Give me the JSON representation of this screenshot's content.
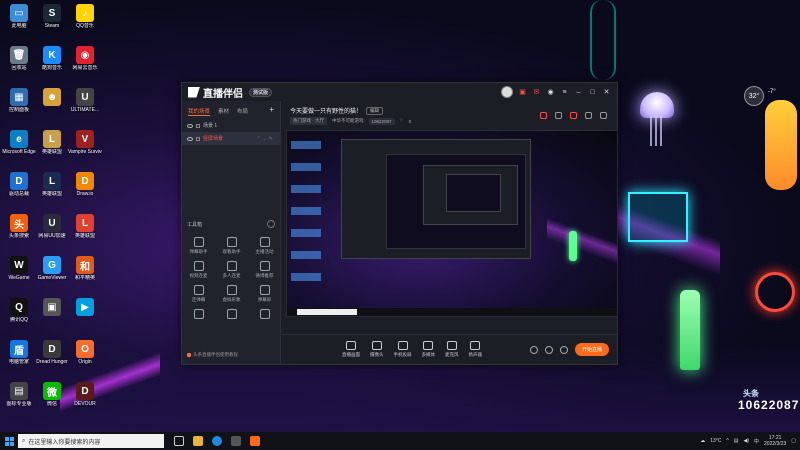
{
  "desktop": {
    "icons": [
      {
        "label": "此电脑",
        "color": "#3c8dd8",
        "glyph": "▭"
      },
      {
        "label": "Steam",
        "color": "#1b2838",
        "glyph": "S"
      },
      {
        "label": "QQ音乐",
        "color": "#ffd400",
        "glyph": "♪"
      },
      {
        "label": "回收站",
        "color": "#6a7a8a",
        "glyph": "🗑"
      },
      {
        "label": "酷狗音乐",
        "color": "#1a8cff",
        "glyph": "K"
      },
      {
        "label": "网易云音乐",
        "color": "#e0232f",
        "glyph": "◉"
      },
      {
        "label": "控制面板",
        "color": "#2f6bb0",
        "glyph": "▦"
      },
      {
        "label": "",
        "color": "#d7a23a",
        "glyph": "☻"
      },
      {
        "label": "ULTIMATE...",
        "color": "#444",
        "glyph": "U"
      },
      {
        "label": "Microsoft Edge",
        "color": "#0c7fc5",
        "glyph": "e"
      },
      {
        "label": "英雄联盟",
        "color": "#c9a04a",
        "glyph": "L"
      },
      {
        "label": "Vampire Survivors",
        "color": "#a02020",
        "glyph": "V"
      },
      {
        "label": "驱动总裁",
        "color": "#2070d0",
        "glyph": "D"
      },
      {
        "label": "英雄联盟",
        "color": "#1a2a50",
        "glyph": "L"
      },
      {
        "label": "Draw.io",
        "color": "#f08705",
        "glyph": "D"
      },
      {
        "label": "头条搜索",
        "color": "#f06010",
        "glyph": "头"
      },
      {
        "label": "网易UU加速",
        "color": "#2a2a3a",
        "glyph": "U"
      },
      {
        "label": "英雄联盟",
        "color": "#e04030",
        "glyph": "L"
      },
      {
        "label": "WeGame",
        "color": "#111",
        "glyph": "W"
      },
      {
        "label": "GameViewer",
        "color": "#2a9df4",
        "glyph": "G"
      },
      {
        "label": "和平精英",
        "color": "#e05a1a",
        "glyph": "和"
      },
      {
        "label": "腾讯QQ",
        "color": "#111",
        "glyph": "Q"
      },
      {
        "label": "",
        "color": "#555",
        "glyph": "▣"
      },
      {
        "label": "",
        "color": "#00a0e0",
        "glyph": "▶"
      },
      {
        "label": "电脑管家",
        "color": "#1676e0",
        "glyph": "盾"
      },
      {
        "label": "Dread Hunger",
        "color": "#3a3a3a",
        "glyph": "D"
      },
      {
        "label": "Origin",
        "color": "#f56c2d",
        "glyph": "O"
      },
      {
        "label": "图标专业版",
        "color": "#444",
        "glyph": "▤"
      },
      {
        "label": "微信",
        "color": "#09bb07",
        "glyph": "微"
      },
      {
        "label": "DEVOUR",
        "color": "#5a1a1a",
        "glyph": "D"
      }
    ]
  },
  "app": {
    "title": "直播伴侣",
    "version_tag": "测试版",
    "tabs": [
      "我的场景",
      "素材",
      "布局"
    ],
    "add_label": "+",
    "scenes": [
      {
        "name": "场景 1",
        "selected": false
      },
      {
        "name": "竖屏场景",
        "selected": true
      }
    ],
    "toolbox_title": "工具箱",
    "tools": [
      "弹幕助手",
      "观看助手",
      "主播活动",
      "视频连麦",
      "多人连麦",
      "微博推荐",
      "连弹幕",
      "虚拟形象",
      "弹幕屏",
      "",
      "",
      ""
    ],
    "notice": "头条直播伴侣使用教程",
    "stream_title": "今天要做一只有野性的猫！",
    "edit_label": "编辑",
    "meta": {
      "category": "热门游戏 · 大厅",
      "room_label": "中华不可能游戏",
      "room_id": "10622087",
      "likes": "0"
    },
    "controls": [
      "直播画面",
      "摄像头",
      "手机投屏",
      "多媒体",
      "麦克风",
      "扬声器"
    ],
    "live_button": "开始直播"
  },
  "overlay": {
    "weather_badge": "32°",
    "weather_temp": "-7°",
    "wall_number": "10622087",
    "wall_logo": "头条"
  },
  "taskbar": {
    "search_placeholder": "在这里输入你要搜索的内容",
    "temperature": "13°C",
    "ime": "中",
    "time": "17:21",
    "date": "2022/3/23"
  }
}
